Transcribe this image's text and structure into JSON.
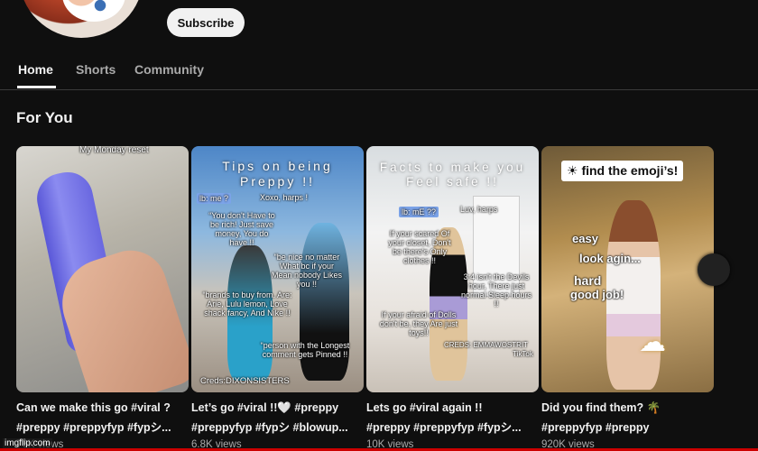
{
  "channel": {
    "subscribe_label": "Subscribe"
  },
  "tabs": [
    {
      "label": "Home",
      "active": true
    },
    {
      "label": "Shorts"
    },
    {
      "label": "Community"
    }
  ],
  "section": {
    "title": "For You"
  },
  "videos": [
    {
      "title_line1": "Can we make this go #viral ?",
      "title_line2": "#preppy #preppyfyp #fypシ...",
      "views": "76K views",
      "overlay": {
        "caption": "My Monday reset"
      }
    },
    {
      "title_line1": "Let’s go #viral !!🤍 #preppy",
      "title_line2": "#preppyfyp #fypシ #blowup...",
      "views": "6.8K views",
      "overlay": {
        "headline": "Tips on being Preppy !!",
        "tag1": "lb: me ?",
        "tag2": "Xoxo, harps !",
        "line1": "“You don't Have to be rich! Just save money, You do have !!",
        "line2": "“be nice no matter What bc if your Mean nobody Likes you !!",
        "line3": "“brands to buy from. Are: Arie, Lulu lemon, Love shack fancy, And Nike !!",
        "line4": "“person with the Longest comment gets Pinned !!",
        "credit": "Creds:DIXONSISTERS"
      }
    },
    {
      "title_line1": "Lets go #viral again !!",
      "title_line2": "#preppy #preppyfyp #fypシ...",
      "views": "10K views",
      "overlay": {
        "headline": "Facts to make you Feel safe !!",
        "tag1": "lb: mE ??",
        "tag2": "Luv, harps",
        "line1": "If your scared Of your closet, Don't be there's Only clothes !!",
        "line2": "3:4 isn't the Devils hour, There just normal Sleep hours !!",
        "line3": "If your afraid of Dolls don't be, they Are just toys!!",
        "credit": "CREDS: EMMAWOSTRIT",
        "brand": "TikTok"
      }
    },
    {
      "title_line1": "Did you find them? 🌴",
      "title_line2": "#preppyfyp #preppy",
      "views": "920K views",
      "overlay": {
        "headline": "find the emoji’s!",
        "l1": "easy",
        "l2": "look agin...",
        "l3": "hard",
        "l4": "good job!"
      }
    }
  ],
  "watermark": "imgflip.com"
}
